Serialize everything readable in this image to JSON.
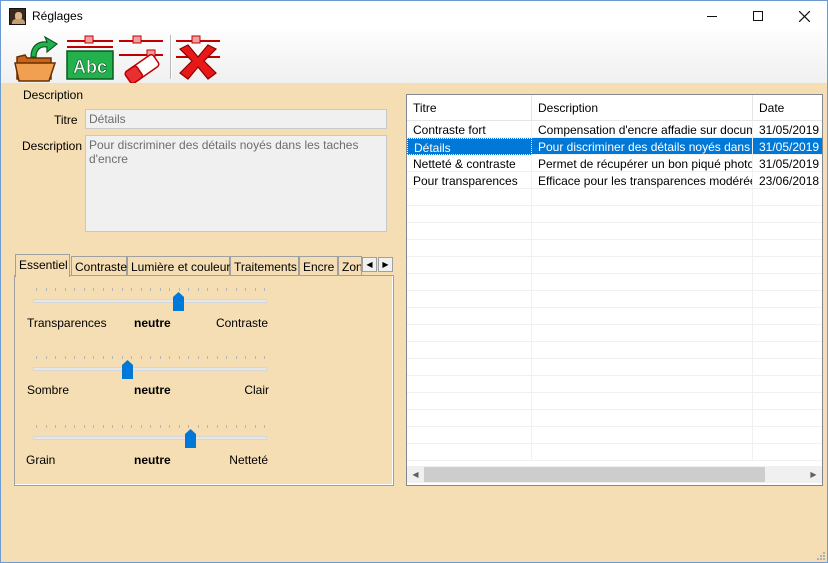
{
  "window": {
    "title": "Réglages",
    "colors": {
      "panel_bg": "#f5deb3",
      "selection": "#0078d7",
      "thumb": "#0078d7"
    }
  },
  "toolbar": {
    "buttons": [
      {
        "name": "open-folder-icon"
      },
      {
        "name": "rename-abc-icon"
      },
      {
        "name": "erase-icon"
      },
      {
        "name": "delete-x-icon"
      }
    ]
  },
  "description_panel": {
    "section_label": "Description",
    "title_label": "Titre",
    "title_value": "Détails",
    "description_label": "Description",
    "description_value": "Pour discriminer des détails noyés dans les taches d'encre"
  },
  "tabs": {
    "items": [
      "Essentiel",
      "Contraste",
      "Lumière et couleurs",
      "Traitements",
      "Encre",
      "Zon"
    ],
    "active": "Essentiel"
  },
  "sliders": [
    {
      "left_label": "Transparences",
      "center_label": "neutre",
      "right_label": "Contraste",
      "value_fraction": 0.62
    },
    {
      "left_label": "Sombre",
      "center_label": "neutre",
      "right_label": "Clair",
      "value_fraction": 0.4
    },
    {
      "left_label": "Grain",
      "center_label": "neutre",
      "right_label": "Netteté",
      "value_fraction": 0.67
    }
  ],
  "grid": {
    "columns": [
      "Titre",
      "Description",
      "Date"
    ],
    "rows": [
      {
        "titre": "Contraste fort",
        "description": "Compensation d'encre affadie sur docume...",
        "date": "31/05/2019"
      },
      {
        "titre": "Détails",
        "description": "Pour discriminer des détails noyés dans les...",
        "date": "31/05/2019",
        "selected": true
      },
      {
        "titre": "Netteté & contraste",
        "description": "Permet de récupérer un bon piqué photogr...",
        "date": "31/05/2019"
      },
      {
        "titre": "Pour transparences",
        "description": "Efficace pour les transparences modérées...",
        "date": "23/06/2018"
      }
    ]
  }
}
